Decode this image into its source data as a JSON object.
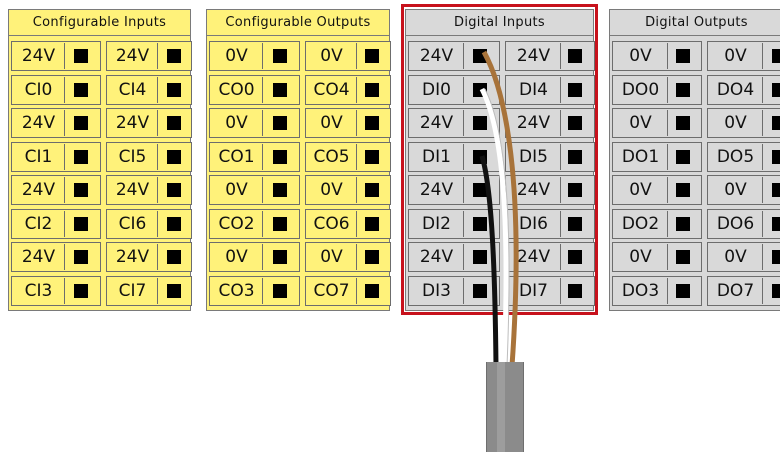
{
  "blocks": [
    {
      "title": "Configurable Inputs",
      "style": "yellow",
      "left": [
        "24V",
        "CI0",
        "24V",
        "CI1",
        "24V",
        "CI2",
        "24V",
        "CI3"
      ],
      "right": [
        "24V",
        "CI4",
        "24V",
        "CI5",
        "24V",
        "CI6",
        "24V",
        "CI7"
      ]
    },
    {
      "title": "Configurable Outputs",
      "style": "yellow",
      "left": [
        "0V",
        "CO0",
        "0V",
        "CO1",
        "0V",
        "CO2",
        "0V",
        "CO3"
      ],
      "right": [
        "0V",
        "CO4",
        "0V",
        "CO5",
        "0V",
        "CO6",
        "0V",
        "CO7"
      ]
    },
    {
      "title": "Digital Inputs",
      "style": "gray",
      "left": [
        "24V",
        "DI0",
        "24V",
        "DI1",
        "24V",
        "DI2",
        "24V",
        "DI3"
      ],
      "right": [
        "24V",
        "DI4",
        "24V",
        "DI5",
        "24V",
        "DI6",
        "24V",
        "DI7"
      ]
    },
    {
      "title": "Digital Outputs",
      "style": "gray",
      "left": [
        "0V",
        "DO0",
        "0V",
        "DO1",
        "0V",
        "DO2",
        "0V",
        "DO3"
      ],
      "right": [
        "0V",
        "DO4",
        "0V",
        "DO5",
        "0V",
        "DO6",
        "0V",
        "DO7"
      ]
    }
  ],
  "highlight": {
    "target": "Digital Inputs",
    "color": "#c7121c"
  },
  "colors": {
    "yellow_panel": "#fff27a",
    "gray_panel": "#d9d9d9",
    "terminal": "#000000",
    "wire_brown": "#a8733a",
    "wire_white": "#ffffff",
    "wire_black": "#111111",
    "cable": "#8b8b8b"
  }
}
